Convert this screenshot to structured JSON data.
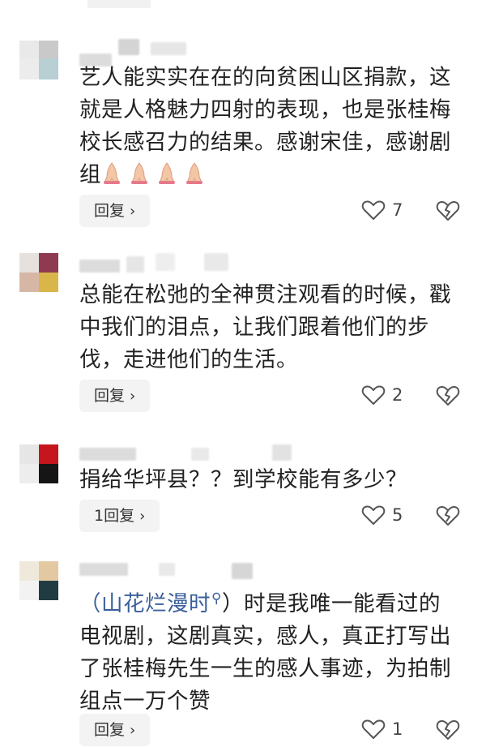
{
  "comments": [
    {
      "text": "艺人能实实在在的向贫困山区捐款，这就是人格魅力四射的表现，也是张桂梅校长感召力的结果。感谢宋佳，感谢剧组",
      "emoji": "folded-hands-emoji x4",
      "reply_label": "回复",
      "likes": "7"
    },
    {
      "text": "总能在松弛的全神贯注观看的时候，戳中我们的泪点，让我们跟着他们的步伐，走进他们的生活。",
      "reply_label": "回复",
      "likes": "2"
    },
    {
      "text": "捐给华坪县？？到学校能有多少？",
      "reply_label": "1回复",
      "likes": "5"
    },
    {
      "link_text": "（山花烂漫时",
      "search_icon": "search-icon",
      "text": "）时是我唯一能看过的电视剧，这剧真实，感人，真正打写出了张桂梅先生一生的感人事迹，为拍制组点一万个赞",
      "reply_label": "回复",
      "likes": "1"
    }
  ],
  "colors": {
    "link": "#3a5f9a",
    "reply_bg": "#f3f3f3",
    "icon": "#555555"
  }
}
